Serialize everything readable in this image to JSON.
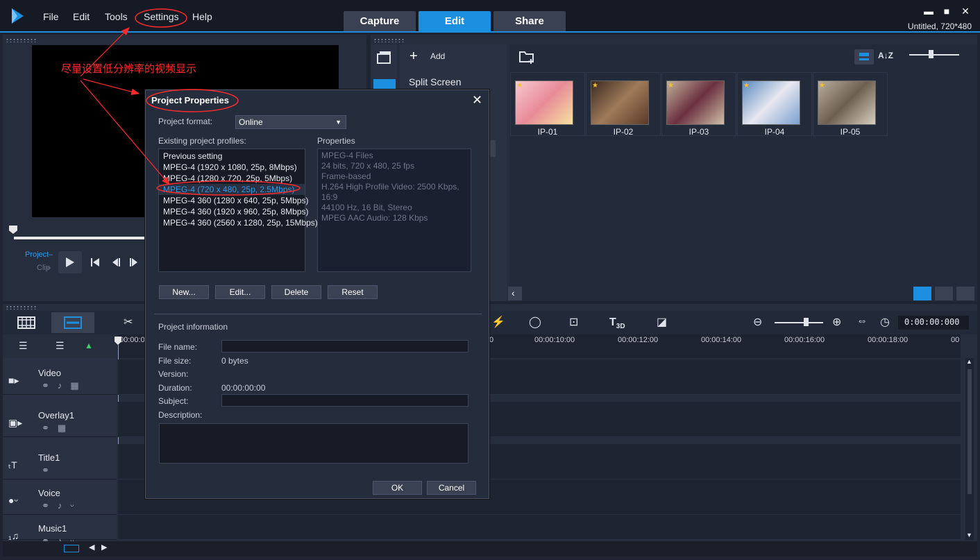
{
  "menu": {
    "file": "File",
    "edit": "Edit",
    "tools": "Tools",
    "settings": "Settings",
    "help": "Help"
  },
  "tabs": [
    {
      "label": "Capture"
    },
    {
      "label": "Edit"
    },
    {
      "label": "Share"
    }
  ],
  "window": {
    "minimize": "▬",
    "maximize": "■",
    "close": "✕",
    "project_title": "Untitled, 720*480"
  },
  "player": {
    "project_label": "Project",
    "clip_label": "Clip"
  },
  "library": {
    "add_label": "Add",
    "category": "Split Screen",
    "items": [
      {
        "label": "IP-01",
        "color": "#f2b8c0"
      },
      {
        "label": "IP-02",
        "color": "#6a4a38"
      },
      {
        "label": "IP-03",
        "color": "#8a6a5a"
      },
      {
        "label": "IP-04",
        "color": "#8fb4d8"
      },
      {
        "label": "IP-05",
        "color": "#9a8e80"
      }
    ]
  },
  "timeline": {
    "timecode": "0:00:00:000",
    "ticks": [
      "00:00:0",
      "0",
      "00:00:10:00",
      "00:00:12:00",
      "00:00:14:00",
      "00:00:16:00",
      "00:00:18:00",
      "00"
    ],
    "tracks": [
      {
        "name": "Video",
        "icon": "video-icon"
      },
      {
        "name": "Overlay1",
        "icon": "overlay-icon"
      },
      {
        "name": "Title1",
        "icon": "title-icon"
      },
      {
        "name": "Voice",
        "icon": "voice-icon"
      },
      {
        "name": "Music1",
        "icon": "music-icon"
      }
    ]
  },
  "annotation": {
    "text": "尽量设置低分辨率的视频显示",
    "color": "#ff2b2b"
  },
  "dialog": {
    "title": "Project Properties",
    "close": "✕",
    "format_label": "Project format:",
    "format_value": "Online",
    "profiles_label": "Existing project profiles:",
    "profiles": [
      "Previous setting",
      "MPEG-4 (1920 x 1080, 25p, 8Mbps)",
      "MPEG-4 (1280 x 720, 25p, 5Mbps)",
      "MPEG-4 (720 x 480, 25p, 2.5Mbps)",
      "MPEG-4 360 (1280 x 640, 25p, 5Mbps)",
      "MPEG-4 360 (1920 x 960, 25p, 8Mbps)",
      "MPEG-4 360 (2560 x 1280, 25p, 15Mbps)"
    ],
    "selected_profile_index": 3,
    "properties_label": "Properties",
    "properties": [
      "MPEG-4 Files",
      "24 bits, 720 x 480, 25 fps",
      "Frame-based",
      "H.264 High Profile Video: 2500 Kbps,",
      "16:9",
      "44100 Hz, 16 Bit, Stereo",
      "MPEG AAC Audio: 128 Kbps"
    ],
    "buttons": {
      "new": "New...",
      "edit": "Edit...",
      "delete": "Delete",
      "reset": "Reset",
      "ok": "OK",
      "cancel": "Cancel"
    },
    "info_label": "Project information",
    "file_name_label": "File name:",
    "file_size_label": "File size:",
    "file_size_value": "0 bytes",
    "version_label": "Version:",
    "duration_label": "Duration:",
    "duration_value": "00:00:00:00",
    "subject_label": "Subject:",
    "description_label": "Description:"
  },
  "colors": {
    "accent": "#1d8fe0",
    "annotation": "#ff2b2b"
  }
}
